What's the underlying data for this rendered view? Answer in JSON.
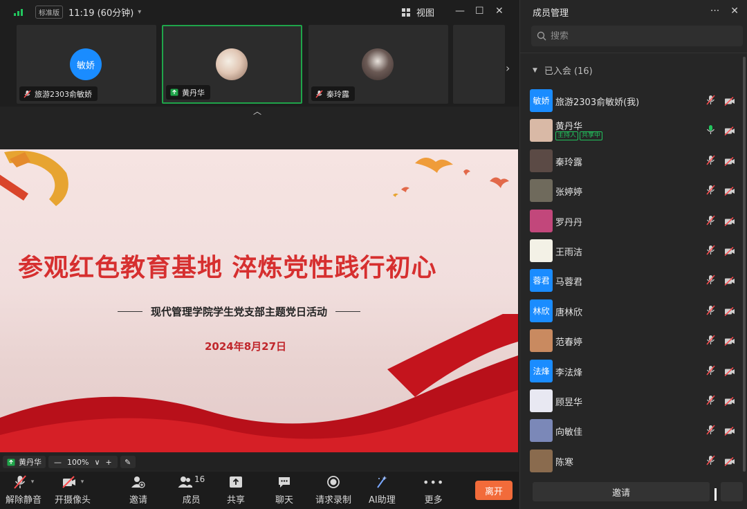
{
  "topbar": {
    "edition": "标准版",
    "time": "11:19 (60分钟)",
    "view_label": "视图"
  },
  "thumbnails": [
    {
      "name": "旅游2303俞敏娇",
      "avatar_text": "敏娇",
      "avatar_color": "#1a8cff",
      "mic": "muted"
    },
    {
      "name": "黄丹华",
      "avatar_text": "",
      "mic": "sharing",
      "active": true
    },
    {
      "name": "秦玲露",
      "avatar_text": "",
      "mic": "muted"
    }
  ],
  "slide": {
    "title": "参观红色教育基地 淬炼党性践行初心",
    "subtitle": "现代管理学院学生党支部主题党日活动",
    "date": "2024年8月27日"
  },
  "share_bar": {
    "sharer": "黄丹华",
    "zoom": "100%"
  },
  "toolbar": {
    "unmute": "解除静音",
    "camera": "开摄像头",
    "invite": "邀请",
    "members": "成员",
    "member_count": "16",
    "share": "共享",
    "chat": "聊天",
    "record": "请求录制",
    "ai": "AI助理",
    "more": "更多",
    "leave": "离开"
  },
  "panel": {
    "title": "成员管理",
    "search_placeholder": "搜索",
    "group_label": "已入会 (16)",
    "invite_label": "邀请"
  },
  "members": [
    {
      "name": "旅游2303俞敏娇(我)",
      "avatar_text": "敏娇",
      "avatar_color": "#1a8cff",
      "mic": "muted"
    },
    {
      "name": "黄丹华",
      "avatar_color": "#d9b9a6",
      "mic": "active",
      "tags": [
        "主持人",
        "共享中"
      ]
    },
    {
      "name": "秦玲露",
      "avatar_color": "#5b4a45",
      "mic": "muted"
    },
    {
      "name": "张婷婷",
      "avatar_color": "#6f6a5c",
      "mic": "muted"
    },
    {
      "name": "罗丹丹",
      "avatar_color": "#c2477b",
      "mic": "muted"
    },
    {
      "name": "王雨洁",
      "avatar_color": "#f3f1e6",
      "mic": "muted"
    },
    {
      "name": "马蓉君",
      "avatar_text": "蓉君",
      "avatar_color": "#1a8cff",
      "mic": "muted"
    },
    {
      "name": "唐林欣",
      "avatar_text": "林欣",
      "avatar_color": "#1a8cff",
      "mic": "muted"
    },
    {
      "name": "范春婷",
      "avatar_color": "#c98a60",
      "mic": "muted"
    },
    {
      "name": "李法烽",
      "avatar_text": "法烽",
      "avatar_color": "#1a8cff",
      "mic": "muted"
    },
    {
      "name": "顾昱华",
      "avatar_color": "#e8e8f2",
      "mic": "muted"
    },
    {
      "name": "向敏佳",
      "avatar_color": "#7b88b8",
      "mic": "muted"
    },
    {
      "name": "陈寒",
      "avatar_color": "#8a6b4e",
      "mic": "muted"
    }
  ]
}
